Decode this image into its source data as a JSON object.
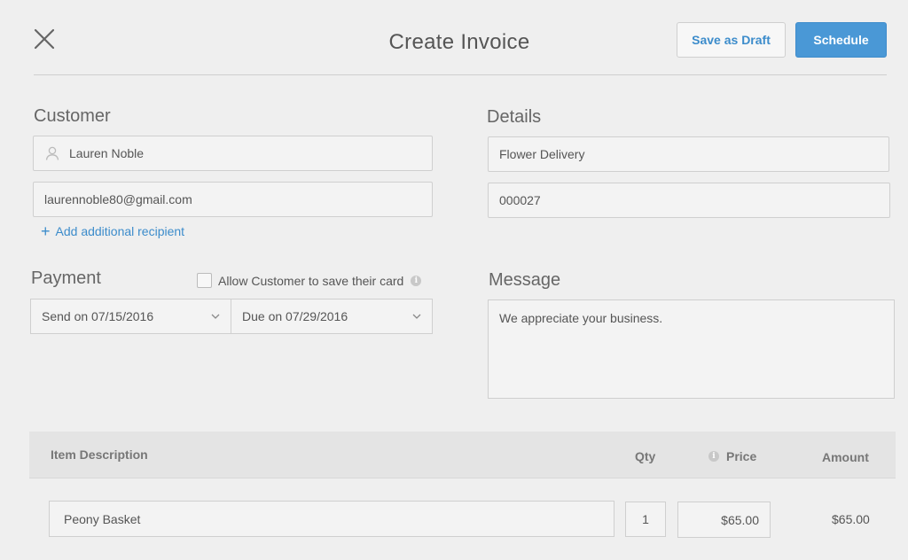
{
  "header": {
    "title": "Create Invoice",
    "save_draft_label": "Save as Draft",
    "schedule_label": "Schedule"
  },
  "customer": {
    "label": "Customer",
    "name": "Lauren Noble",
    "email": "laurennoble80@gmail.com",
    "add_recipient_label": "Add additional recipient"
  },
  "details": {
    "label": "Details",
    "title": "Flower Delivery",
    "number": "000027"
  },
  "payment": {
    "label": "Payment",
    "allow_save_card_label": "Allow Customer to save their card",
    "allow_save_card_checked": false,
    "send_on": "Send on 07/15/2016",
    "due_on": "Due on 07/29/2016"
  },
  "message": {
    "label": "Message",
    "text": "We appreciate your business."
  },
  "items": {
    "columns": {
      "description": "Item Description",
      "qty": "Qty",
      "price": "Price",
      "amount": "Amount"
    },
    "rows": [
      {
        "description": "Peony Basket",
        "qty": "1",
        "price": "$65.00",
        "amount": "$65.00"
      }
    ]
  },
  "icons": {
    "close": "close-icon",
    "person": "person-icon",
    "plus": "plus-icon",
    "info": "info-icon",
    "chevron": "chevron-down-icon"
  },
  "colors": {
    "accent": "#4a98d6",
    "link": "#3c8ccb",
    "background": "#efefef"
  }
}
